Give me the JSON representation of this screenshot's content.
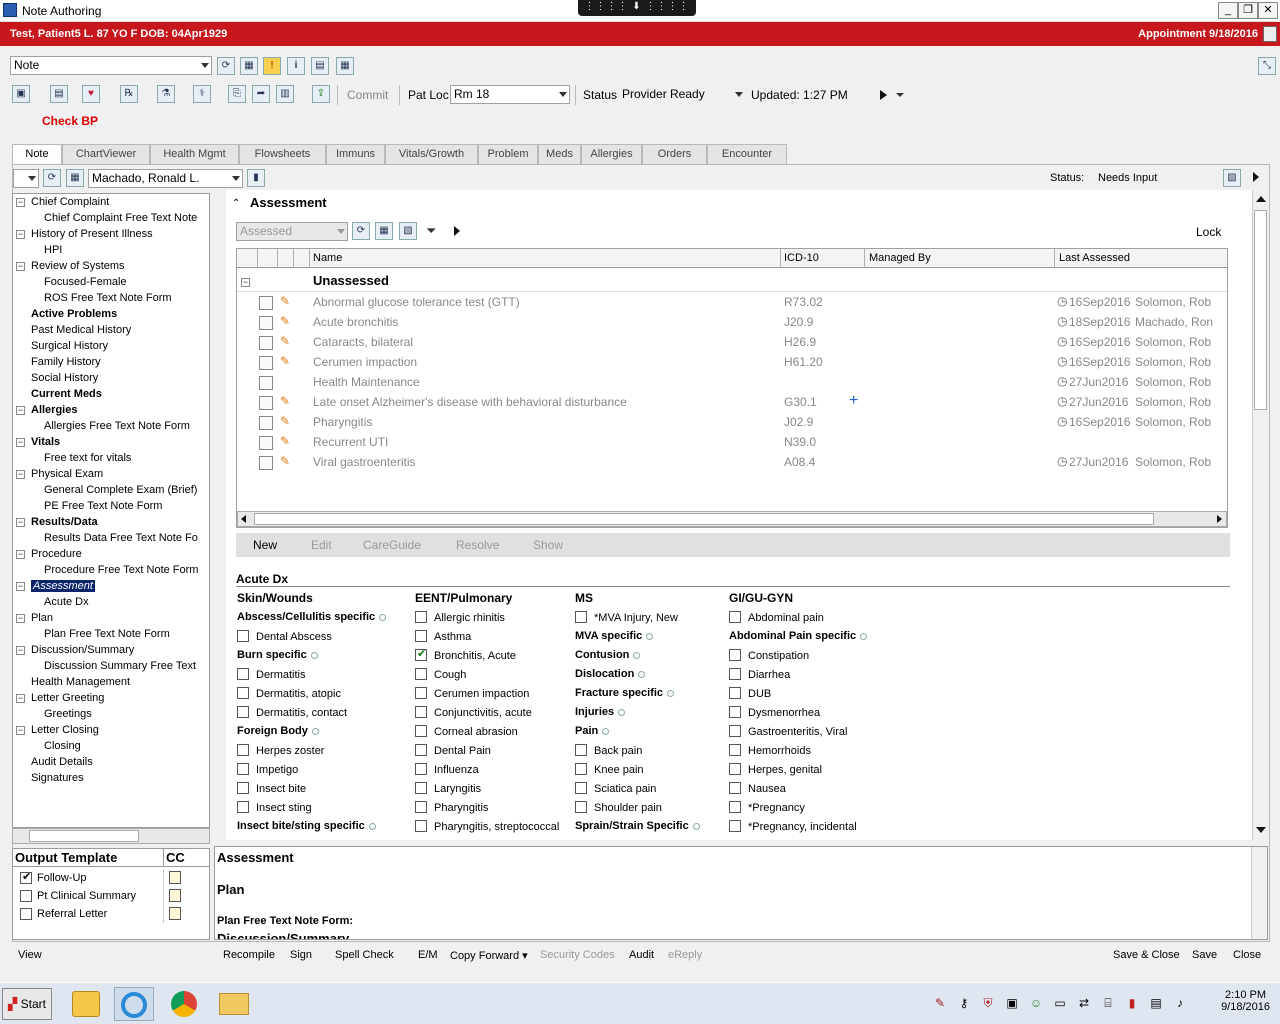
{
  "window": {
    "title": "Note Authoring"
  },
  "remote_bar": {
    "label": "⋮⋮⋮⋮ ⬇ ⋮⋮⋮⋮"
  },
  "patient_banner": {
    "patient": "Test, Patient5 L.  87 YO  F DOB: 04Apr1929",
    "appointment": "Appointment  9/18/2016"
  },
  "toolbar1": {
    "note_type": "Note"
  },
  "toolbar2": {
    "commit": "Commit",
    "pat_loc_label": "Pat Loc",
    "pat_loc_value": "Rm 18",
    "status_label": "Status",
    "status_value": "Provider Ready",
    "updated": "Updated: 1:27 PM"
  },
  "alert": {
    "text": "Check BP"
  },
  "tabs": [
    "Note",
    "ChartViewer",
    "Health Mgmt",
    "Flowsheets",
    "Immuns",
    "Vitals/Growth",
    "Problem",
    "Meds",
    "Allergies",
    "Orders",
    "Encounter"
  ],
  "note_header": {
    "provider": "Machado, Ronald L.",
    "status_label": "Status:",
    "status_value": "Needs Input"
  },
  "tree": [
    {
      "label": "Chief Complaint",
      "level": 0,
      "exp": true,
      "bold": false
    },
    {
      "label": "Chief Complaint Free Text Note",
      "level": 1
    },
    {
      "label": "History of Present Illness",
      "level": 0,
      "exp": true
    },
    {
      "label": "HPI",
      "level": 1
    },
    {
      "label": "Review of Systems",
      "level": 0,
      "exp": true
    },
    {
      "label": "Focused-Female",
      "level": 1
    },
    {
      "label": "ROS Free Text Note Form",
      "level": 1
    },
    {
      "label": "Active Problems",
      "level": 0,
      "bold": true
    },
    {
      "label": "Past Medical History",
      "level": 0
    },
    {
      "label": "Surgical History",
      "level": 0
    },
    {
      "label": "Family History",
      "level": 0
    },
    {
      "label": "Social History",
      "level": 0
    },
    {
      "label": "Current Meds",
      "level": 0,
      "bold": true
    },
    {
      "label": "Allergies",
      "level": 0,
      "exp": true,
      "bold": true
    },
    {
      "label": "Allergies Free Text Note Form",
      "level": 1
    },
    {
      "label": "Vitals",
      "level": 0,
      "exp": true,
      "bold": true
    },
    {
      "label": "Free text for vitals",
      "level": 1
    },
    {
      "label": "Physical Exam",
      "level": 0,
      "exp": true
    },
    {
      "label": "General Complete Exam (Brief)",
      "level": 1
    },
    {
      "label": "PE Free Text Note Form",
      "level": 1
    },
    {
      "label": "Results/Data",
      "level": 0,
      "exp": true,
      "bold": true
    },
    {
      "label": "Results Data Free Text Note Fo",
      "level": 1
    },
    {
      "label": "Procedure",
      "level": 0,
      "exp": true
    },
    {
      "label": "Procedure Free Text Note Form",
      "level": 1
    },
    {
      "label": "Assessment",
      "level": 0,
      "exp": true,
      "selected": true
    },
    {
      "label": "Acute Dx",
      "level": 1
    },
    {
      "label": "Plan",
      "level": 0,
      "exp": true
    },
    {
      "label": "Plan Free Text Note Form",
      "level": 1
    },
    {
      "label": "Discussion/Summary",
      "level": 0,
      "exp": true
    },
    {
      "label": "Discussion Summary Free Text",
      "level": 1
    },
    {
      "label": "Health Management",
      "level": 0
    },
    {
      "label": "Letter Greeting",
      "level": 0,
      "exp": true
    },
    {
      "label": "Greetings",
      "level": 1
    },
    {
      "label": "Letter Closing",
      "level": 0,
      "exp": true
    },
    {
      "label": "Closing",
      "level": 1
    },
    {
      "label": "Audit Details",
      "level": 0
    },
    {
      "label": "Signatures",
      "level": 0
    }
  ],
  "output_template": {
    "header": "Output Template",
    "cc": "CC",
    "items": [
      {
        "label": "Follow-Up",
        "checked": true
      },
      {
        "label": "Pt Clinical Summary",
        "checked": false
      },
      {
        "label": "Referral Letter",
        "checked": false
      }
    ]
  },
  "assessment": {
    "title": "Assessment",
    "filter_value": "Assessed",
    "lock": "Lock",
    "columns": [
      "Name",
      "ICD-10",
      "Managed By",
      "Last Assessed"
    ],
    "group": "Unassessed",
    "rows": [
      {
        "name": "Abnormal glucose tolerance test (GTT)",
        "icd": "R73.02",
        "date": "16Sep2016",
        "by": "Solomon, Rob",
        "pencil": true
      },
      {
        "name": "Acute bronchitis",
        "icd": "J20.9",
        "date": "18Sep2016",
        "by": "Machado, Ron",
        "pencil": true
      },
      {
        "name": "Cataracts, bilateral",
        "icd": "H26.9",
        "date": "16Sep2016",
        "by": "Solomon, Rob",
        "pencil": true
      },
      {
        "name": "Cerumen impaction",
        "icd": "H61.20",
        "date": "16Sep2016",
        "by": "Solomon, Rob",
        "pencil": true
      },
      {
        "name": "Health Maintenance",
        "icd": "",
        "date": "27Jun2016",
        "by": "Solomon, Rob",
        "pencil": false
      },
      {
        "name": "Late onset Alzheimer's disease with behavioral disturbance",
        "icd": "G30.1",
        "date": "27Jun2016",
        "by": "Solomon, Rob",
        "pencil": true,
        "plus": "+"
      },
      {
        "name": "Pharyngitis",
        "icd": "J02.9",
        "date": "16Sep2016",
        "by": "Solomon, Rob",
        "pencil": true
      },
      {
        "name": "Recurrent UTI",
        "icd": "N39.0",
        "date": "",
        "by": "",
        "pencil": true
      },
      {
        "name": "Viral gastroenteritis",
        "icd": "A08.4",
        "date": "27Jun2016",
        "by": "Solomon, Rob",
        "pencil": true
      }
    ],
    "buttons": [
      "New",
      "Edit",
      "CareGuide",
      "Resolve",
      "Show"
    ]
  },
  "acute_dx": {
    "title": "Acute Dx",
    "columns": [
      {
        "header": "Skin/Wounds",
        "items": [
          {
            "t": "b",
            "label": "Abscess/Cellulitis specific"
          },
          {
            "t": "c",
            "label": "Dental Abscess"
          },
          {
            "t": "b",
            "label": "Burn specific"
          },
          {
            "t": "c",
            "label": "Dermatitis"
          },
          {
            "t": "c",
            "label": "Dermatitis, atopic"
          },
          {
            "t": "c",
            "label": "Dermatitis, contact"
          },
          {
            "t": "b",
            "label": "Foreign Body"
          },
          {
            "t": "c",
            "label": "Herpes zoster"
          },
          {
            "t": "c",
            "label": "Impetigo"
          },
          {
            "t": "c",
            "label": "Insect bite"
          },
          {
            "t": "c",
            "label": "Insect sting"
          },
          {
            "t": "b",
            "label": "Insect bite/sting specific"
          }
        ]
      },
      {
        "header": "EENT/Pulmonary",
        "items": [
          {
            "t": "c",
            "label": "Allergic rhinitis"
          },
          {
            "t": "c",
            "label": "Asthma"
          },
          {
            "t": "c",
            "label": "Bronchitis, Acute",
            "checked": true
          },
          {
            "t": "c",
            "label": "Cough"
          },
          {
            "t": "c",
            "label": "Cerumen impaction"
          },
          {
            "t": "c",
            "label": "Conjunctivitis, acute"
          },
          {
            "t": "c",
            "label": "Corneal abrasion"
          },
          {
            "t": "c",
            "label": "Dental Pain"
          },
          {
            "t": "c",
            "label": "Influenza"
          },
          {
            "t": "c",
            "label": "Laryngitis"
          },
          {
            "t": "c",
            "label": "Pharyngitis"
          },
          {
            "t": "c",
            "label": "Pharyngitis, streptococcal"
          }
        ]
      },
      {
        "header": "MS",
        "items": [
          {
            "t": "c",
            "label": "*MVA Injury, New"
          },
          {
            "t": "b",
            "label": "MVA specific"
          },
          {
            "t": "b",
            "label": "Contusion"
          },
          {
            "t": "b",
            "label": "Dislocation"
          },
          {
            "t": "b",
            "label": "Fracture specific"
          },
          {
            "t": "b",
            "label": "Injuries"
          },
          {
            "t": "b",
            "label": "Pain"
          },
          {
            "t": "c",
            "label": "Back pain"
          },
          {
            "t": "c",
            "label": "Knee pain"
          },
          {
            "t": "c",
            "label": "Sciatica pain"
          },
          {
            "t": "c",
            "label": "Shoulder pain"
          },
          {
            "t": "b",
            "label": "Sprain/Strain Specific"
          }
        ]
      },
      {
        "header": "GI/GU-GYN",
        "items": [
          {
            "t": "c",
            "label": "Abdominal pain"
          },
          {
            "t": "b",
            "label": "Abdominal Pain specific"
          },
          {
            "t": "c",
            "label": "Constipation"
          },
          {
            "t": "c",
            "label": "Diarrhea"
          },
          {
            "t": "c",
            "label": "DUB"
          },
          {
            "t": "c",
            "label": "Dysmenorrhea"
          },
          {
            "t": "c",
            "label": "Gastroenteritis, Viral"
          },
          {
            "t": "c",
            "label": "Hemorrhoids"
          },
          {
            "t": "c",
            "label": "Herpes, genital"
          },
          {
            "t": "c",
            "label": "Nausea"
          },
          {
            "t": "c",
            "label": "*Pregnancy"
          },
          {
            "t": "c",
            "label": "*Pregnancy, incidental"
          }
        ]
      }
    ]
  },
  "preview": {
    "assessment": "Assessment",
    "plan": "Plan",
    "plan_form": "Plan Free Text Note Form:",
    "discussion": "Discussion/Summary"
  },
  "bottom_bar": {
    "view": "View",
    "buttons": [
      "Recompile",
      "Sign",
      "Spell Check",
      "E/M",
      "Copy Forward ▾",
      "Security Codes",
      "Audit",
      "eReply"
    ],
    "right": [
      "Save & Close",
      "Save",
      "Close"
    ]
  },
  "taskbar": {
    "start": "Start",
    "time": "2:10 PM",
    "date": "9/18/2016"
  },
  "colors": {
    "banner_red": "#c8161d",
    "selection": "#0a246a",
    "alert_red": "#dd0000",
    "plus_blue": "#2060d0"
  }
}
